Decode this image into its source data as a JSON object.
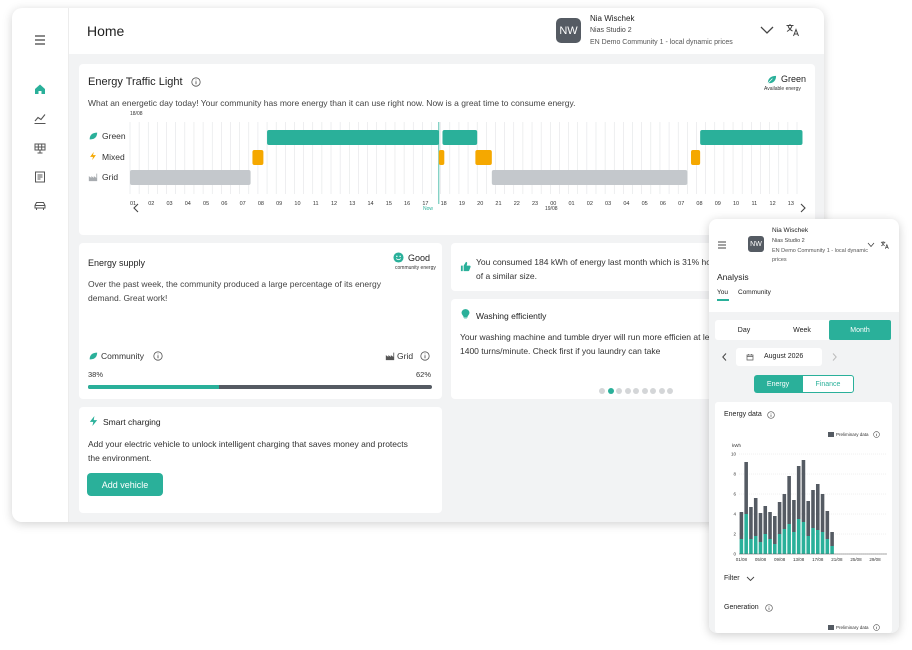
{
  "colors": {
    "teal": "#2ab09a",
    "orange": "#f5a800",
    "grey": "#c4c8cc",
    "dark": "#555b63"
  },
  "header": {
    "title": "Home"
  },
  "user": {
    "initials": "NW",
    "name": "Nia Wischek",
    "studio": "Nias Studio 2",
    "community": "EN Demo Community 1 - local dynamic prices"
  },
  "sidebar": {
    "items": [
      "menu-icon",
      "home-icon",
      "analytics-icon",
      "solar-panel-icon",
      "document-icon",
      "car-icon"
    ]
  },
  "traffic_light": {
    "title": "Energy Traffic Light",
    "status": "Green",
    "status_sub": "Available energy",
    "description": "What an energetic day today! Your community has more energy than it can use right now. Now is a great time to consume energy.",
    "date_start": "18/08",
    "date_next": "19/08",
    "now_label": "Now",
    "rows": [
      {
        "label": "Green",
        "color": "#2ab09a"
      },
      {
        "label": "Mixed",
        "color": "#f5a800"
      },
      {
        "label": "Grid",
        "color": "#c4c8cc"
      }
    ],
    "hours": [
      "01",
      "02",
      "03",
      "04",
      "05",
      "06",
      "07",
      "08",
      "09",
      "10",
      "11",
      "12",
      "13",
      "14",
      "15",
      "16",
      "17",
      "18",
      "19",
      "20",
      "21",
      "22",
      "23",
      "00",
      "01",
      "02",
      "03",
      "04",
      "05",
      "06",
      "07",
      "08",
      "09",
      "10",
      "11",
      "12",
      "13"
    ],
    "blocks": [
      {
        "row": 0,
        "from": 7.5,
        "to": 16.9
      },
      {
        "row": 0,
        "from": 17.1,
        "to": 19.0
      },
      {
        "row": 0,
        "from": 31.2,
        "to": 36.8
      },
      {
        "row": 1,
        "from": 6.7,
        "to": 7.3
      },
      {
        "row": 1,
        "from": 16.9,
        "to": 17.2
      },
      {
        "row": 1,
        "from": 18.9,
        "to": 19.8
      },
      {
        "row": 1,
        "from": 30.7,
        "to": 31.2
      },
      {
        "row": 2,
        "from": 0.0,
        "to": 6.6
      },
      {
        "row": 2,
        "from": 19.8,
        "to": 30.5
      }
    ],
    "now_position": 16.9
  },
  "energy_supply": {
    "title": "Energy supply",
    "status": "Good",
    "status_sub": "community energy",
    "description": "Over the past week, the community produced a large percentage of its energy demand. Great work!",
    "community_label": "Community",
    "grid_label": "Grid",
    "community_percent": "38%",
    "grid_percent": "62%",
    "community_fraction": 0.38
  },
  "consumption": {
    "text": "You consumed 184 kWh of energy last month which is 31% households of a similar size."
  },
  "washing": {
    "title": "Washing efficiently",
    "text": "Your washing machine and tumble dryer will run more efficien at least 1400 turns/minute. Check first if you laundry can take",
    "dots": 9,
    "active_dot": 1
  },
  "smart_charging": {
    "title": "Smart charging",
    "text": "Add your electric vehicle to unlock intelligent charging that saves money and protects the environment.",
    "button": "Add vehicle"
  },
  "mobile": {
    "initials": "NW",
    "name": "Nia Wischek",
    "studio": "Nias Studio 2",
    "community": "EN Demo Community 1 - local dynamic prices",
    "section": "Analysis",
    "tabs": [
      "You",
      "Community"
    ],
    "period_tabs": [
      "Day",
      "Week",
      "Month"
    ],
    "active_period": "Month",
    "month": "August 2026",
    "mode_tabs": [
      "Energy",
      "Finance"
    ],
    "active_mode": "Energy",
    "energy_data_title": "Energy data",
    "preliminary": "Preliminary data",
    "filter_label": "Filter",
    "generation_title": "Generation"
  },
  "chart_data": {
    "type": "bar",
    "ylabel": "kWh",
    "ylim": [
      0,
      10
    ],
    "yticks": [
      0,
      2,
      4,
      6,
      8,
      10
    ],
    "xticks": [
      "01/08",
      "05/08",
      "09/08",
      "13/08",
      "17/08",
      "21/08",
      "25/08",
      "29/08"
    ],
    "days": 31,
    "series": [
      {
        "values": [
          4.2,
          9.2,
          4.7,
          5.6,
          4.1,
          4.8,
          4.2,
          3.8,
          5.2,
          6.0,
          7.8,
          5.4,
          8.8,
          9.4,
          5.3,
          6.4,
          7.0,
          6.0,
          4.3,
          2.2,
          0,
          0,
          0,
          0,
          0,
          0,
          0,
          0,
          0,
          0,
          0
        ]
      },
      {
        "values": [
          1.5,
          4.0,
          1.5,
          1.8,
          1.2,
          2.0,
          1.5,
          1.0,
          2.0,
          2.5,
          3.0,
          2.2,
          3.5,
          3.2,
          1.8,
          2.6,
          2.4,
          2.2,
          1.5,
          0.8,
          0,
          0,
          0,
          0,
          0,
          0,
          0,
          0,
          0,
          0,
          0
        ]
      }
    ]
  }
}
